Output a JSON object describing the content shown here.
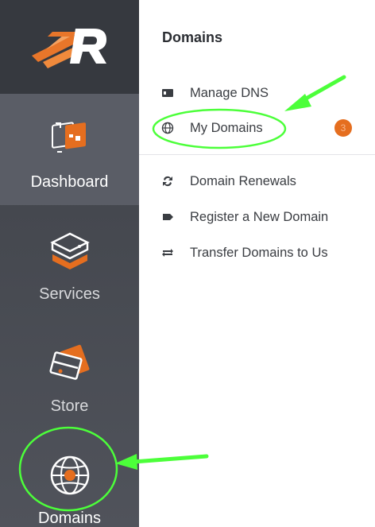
{
  "colors": {
    "accent": "#e56e1f",
    "rail": "#45484f",
    "annotation": "#4cff3a"
  },
  "rail": {
    "items": [
      {
        "label": "Dashboard",
        "icon": "dashboard-icon",
        "active": true
      },
      {
        "label": "Services",
        "icon": "services-icon",
        "active": false
      },
      {
        "label": "Store",
        "icon": "store-icon",
        "active": false
      },
      {
        "label": "Domains",
        "icon": "globe-icon",
        "active": false
      }
    ]
  },
  "panel": {
    "title": "Domains",
    "items": [
      {
        "label": "Manage DNS",
        "icon": "dns-icon"
      },
      {
        "label": "My Domains",
        "icon": "globe-small-icon",
        "badge": "3"
      },
      {
        "label": "Domain Renewals",
        "icon": "refresh-icon"
      },
      {
        "label": "Register a New Domain",
        "icon": "tag-icon"
      },
      {
        "label": "Transfer Domains to Us",
        "icon": "transfer-icon"
      }
    ]
  }
}
